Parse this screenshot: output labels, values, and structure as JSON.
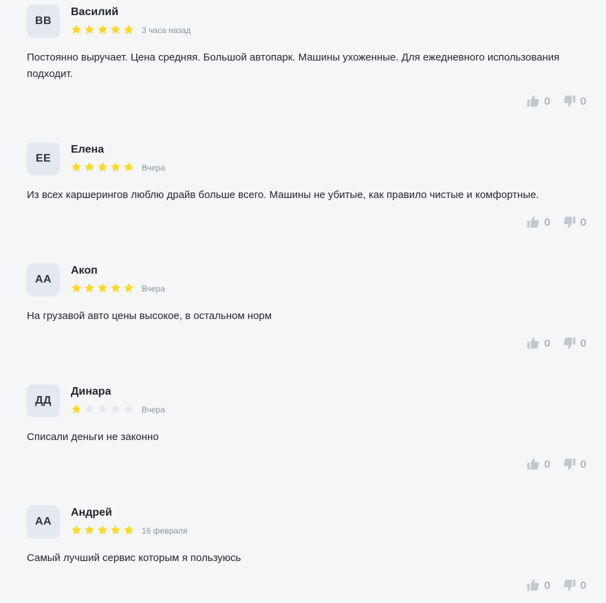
{
  "colors": {
    "star_filled": "#fcd823",
    "star_empty": "#e6eaf0",
    "avatar_bg": "#e4e8ef",
    "vote_icon": "#c3c8cf"
  },
  "reviews": [
    {
      "initials": "ВВ",
      "name": "Василий",
      "rating": 5,
      "date": "3 часа назад",
      "text": "Постоянно выручает. Цена средняя. Большой автопарк. Машины ухоженные. Для ежедневного использования подходит.",
      "likes": "0",
      "dislikes": "0"
    },
    {
      "initials": "ЕЕ",
      "name": "Елена",
      "rating": 5,
      "date": "Вчера",
      "text": "Из всех каршерингов люблю драйв больше всего. Машины не убитые, как правило чистые и комфортные.",
      "likes": "0",
      "dislikes": "0"
    },
    {
      "initials": "АА",
      "name": "Акоп",
      "rating": 5,
      "date": "Вчера",
      "text": "На грузавой авто цены высокое, в остальном норм",
      "likes": "0",
      "dislikes": "0"
    },
    {
      "initials": "ДД",
      "name": "Динара",
      "rating": 1,
      "date": "Вчера",
      "text": "Списали деньги не законно",
      "likes": "0",
      "dislikes": "0"
    },
    {
      "initials": "АА",
      "name": "Андрей",
      "rating": 5,
      "date": "16 февраля",
      "text": "Самый лучший сервис которым я пользуюсь",
      "likes": "0",
      "dislikes": "0"
    }
  ]
}
